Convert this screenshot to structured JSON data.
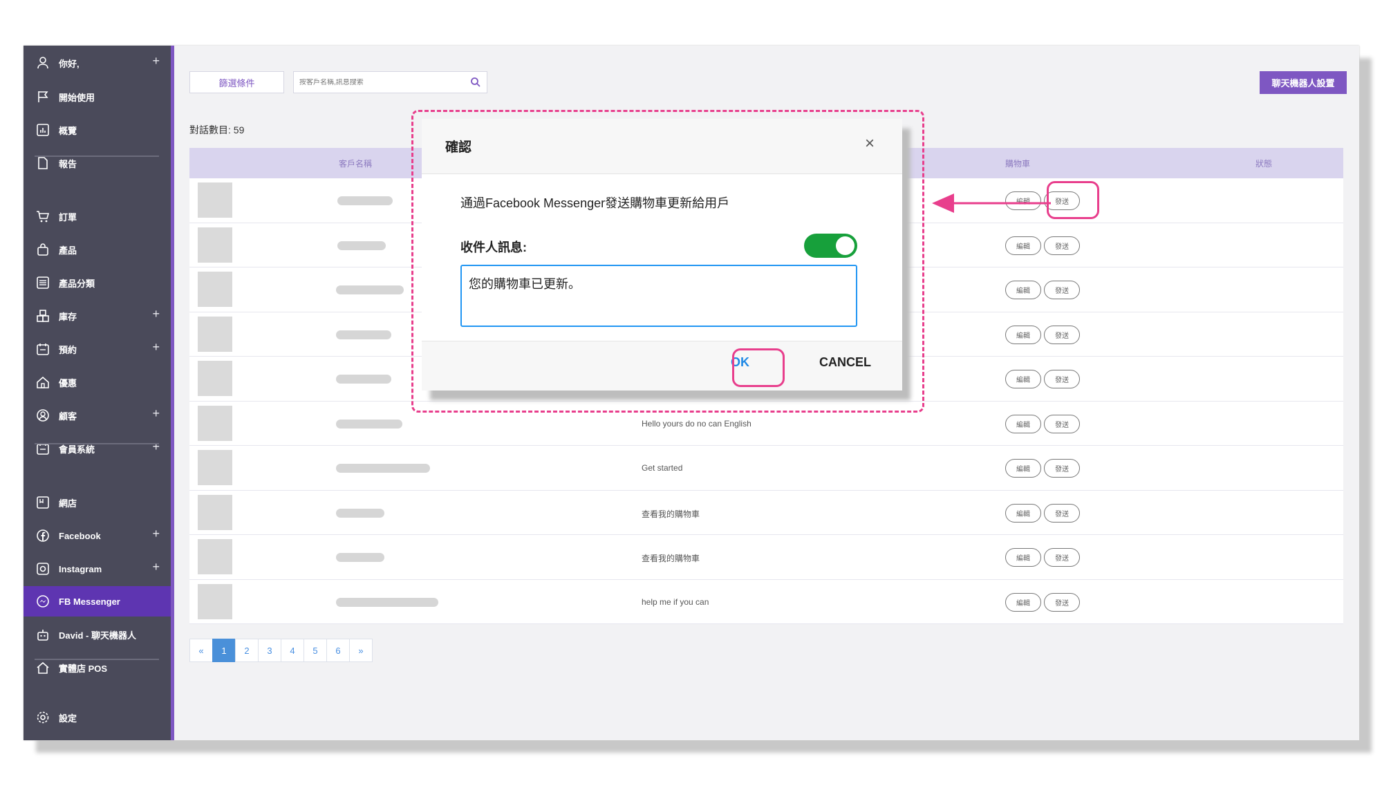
{
  "sidebar": {
    "items": [
      {
        "label": "你好,",
        "icon": "user-icon",
        "plus": "+"
      },
      {
        "label": "開始使用",
        "icon": "flag-icon"
      },
      {
        "label": "概覽",
        "icon": "chart-icon"
      },
      {
        "label": "報告",
        "icon": "document-icon"
      },
      {
        "label": "訂單",
        "icon": "cart-icon"
      },
      {
        "label": "產品",
        "icon": "bag-icon"
      },
      {
        "label": "產品分類",
        "icon": "list-icon"
      },
      {
        "label": "庫存",
        "icon": "boxes-icon",
        "plus": "+"
      },
      {
        "label": "預約",
        "icon": "calendar-icon",
        "plus": "+"
      },
      {
        "label": "優惠",
        "icon": "home-tag-icon"
      },
      {
        "label": "顧客",
        "icon": "customer-icon",
        "plus": "+"
      },
      {
        "label": "會員系統",
        "icon": "calendar-icon",
        "plus": "+"
      },
      {
        "label": "網店",
        "icon": "store-icon"
      },
      {
        "label": "Facebook",
        "icon": "facebook-icon",
        "plus": "+"
      },
      {
        "label": "Instagram",
        "icon": "instagram-icon",
        "plus": "+"
      },
      {
        "label": "FB Messenger",
        "icon": "messenger-icon",
        "active": true
      },
      {
        "label": "David - 聊天機器人",
        "icon": "robot-icon"
      },
      {
        "label": "實體店 POS",
        "icon": "shop-icon"
      },
      {
        "label": "設定",
        "icon": "gear-icon"
      }
    ]
  },
  "toolbar": {
    "filter_label": "篩選條件",
    "search_placeholder": "按客戶名稱,訊息搜索",
    "bot_settings_label": "聊天機器人設置"
  },
  "conversation_count": "對話數目: 59",
  "table": {
    "headers": {
      "customer": "客戶名稱",
      "cart": "購物車",
      "status": "狀態"
    },
    "edit_label": "編輯",
    "send_label": "發送",
    "rows": [
      {
        "message": ""
      },
      {
        "message": ""
      },
      {
        "message": ""
      },
      {
        "message": ""
      },
      {
        "message": ""
      },
      {
        "message": "Hello yours do no can English"
      },
      {
        "message": "Get started"
      },
      {
        "message": "查看我的購物車"
      },
      {
        "message": "查看我的購物車"
      },
      {
        "message": "help me if you can"
      }
    ]
  },
  "pagination": {
    "prev": "«",
    "pages": [
      "1",
      "2",
      "3",
      "4",
      "5",
      "6"
    ],
    "next": "»",
    "current": "1"
  },
  "modal": {
    "title": "確認",
    "close": "×",
    "description": "通過Facebook Messenger發送購物車更新給用戶",
    "recipient_label": "收件人訊息:",
    "toggle_on": true,
    "message_value": "您的購物車已更新。",
    "ok_label": "OK",
    "cancel_label": "CANCEL"
  },
  "colors": {
    "accent": "#7e57c2",
    "sidebar_bg": "#4a4a5a",
    "highlight": "#e83e8c",
    "toggle": "#17a03b",
    "ok": "#1e88e5"
  }
}
